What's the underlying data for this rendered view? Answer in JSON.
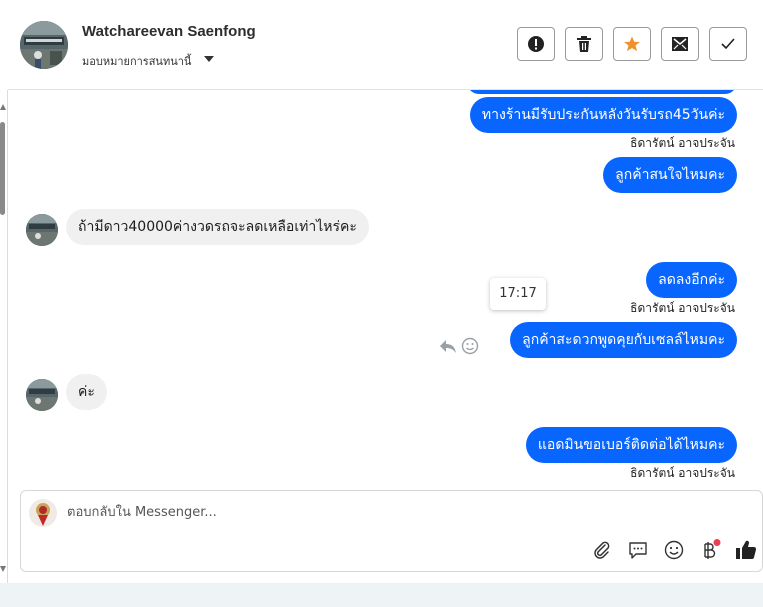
{
  "header": {
    "contact_name": "Watchareevan Saenfong",
    "assign_label": "มอบหมายการสนทนานี้",
    "actions": [
      {
        "name": "alert-button",
        "icon": "exclamation-icon"
      },
      {
        "name": "delete-button",
        "icon": "trash-icon"
      },
      {
        "name": "star-button",
        "icon": "star-icon",
        "color": "#f0922a"
      },
      {
        "name": "mark-unread-button",
        "icon": "mail-icon"
      },
      {
        "name": "done-button",
        "icon": "check-icon"
      }
    ]
  },
  "messages": {
    "out_1": "ทางร้านมีรับประกันหลังวันรับรถ45วันค่ะ",
    "out_1_sender": "ธิดารัตน์ อาจประจัน",
    "out_2": "ลูกค้าสนใจไหมคะ",
    "in_1": "ถ้ามีดาว40000ค่างวดรถจะลดเหลือเท่าไหร่คะ",
    "out_3": "ลดลงอีกค่ะ",
    "out_3_sender": "ธิดารัตน์ อาจประจัน",
    "tooltip_time": "17:17",
    "out_4": "ลูกค้าสะดวกพูดคุยกับเซลล์ไหมคะ",
    "in_2": "ค่ะ",
    "out_5": "แอดมินขอเบอร์ติดต่อได้ไหมคะ",
    "out_5_sender": "ธิดารัตน์ อาจประจัน"
  },
  "composer": {
    "placeholder": "ตอบกลับใน Messenger..."
  },
  "colors": {
    "outgoing_bubble": "#0866ff",
    "incoming_bubble": "#f0f0f0",
    "star": "#f0922a",
    "notification_dot": "#e8414f"
  }
}
